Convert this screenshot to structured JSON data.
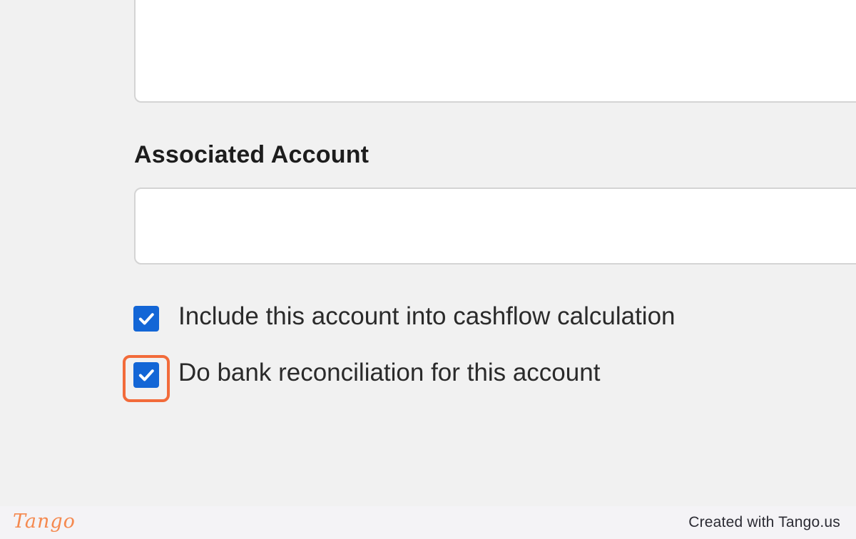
{
  "form": {
    "associated_account_label": "Associated Account",
    "associated_account_value": "",
    "checkboxes": [
      {
        "label": "Include this account into cashflow calculation",
        "checked": true
      },
      {
        "label": "Do bank reconciliation for this account",
        "checked": true,
        "highlighted": true
      }
    ]
  },
  "colors": {
    "checkbox": "#1366d6",
    "highlight": "#f26b3a",
    "brand": "#f5894f"
  },
  "footer": {
    "logo": "Tango",
    "credit": "Created with Tango.us"
  }
}
